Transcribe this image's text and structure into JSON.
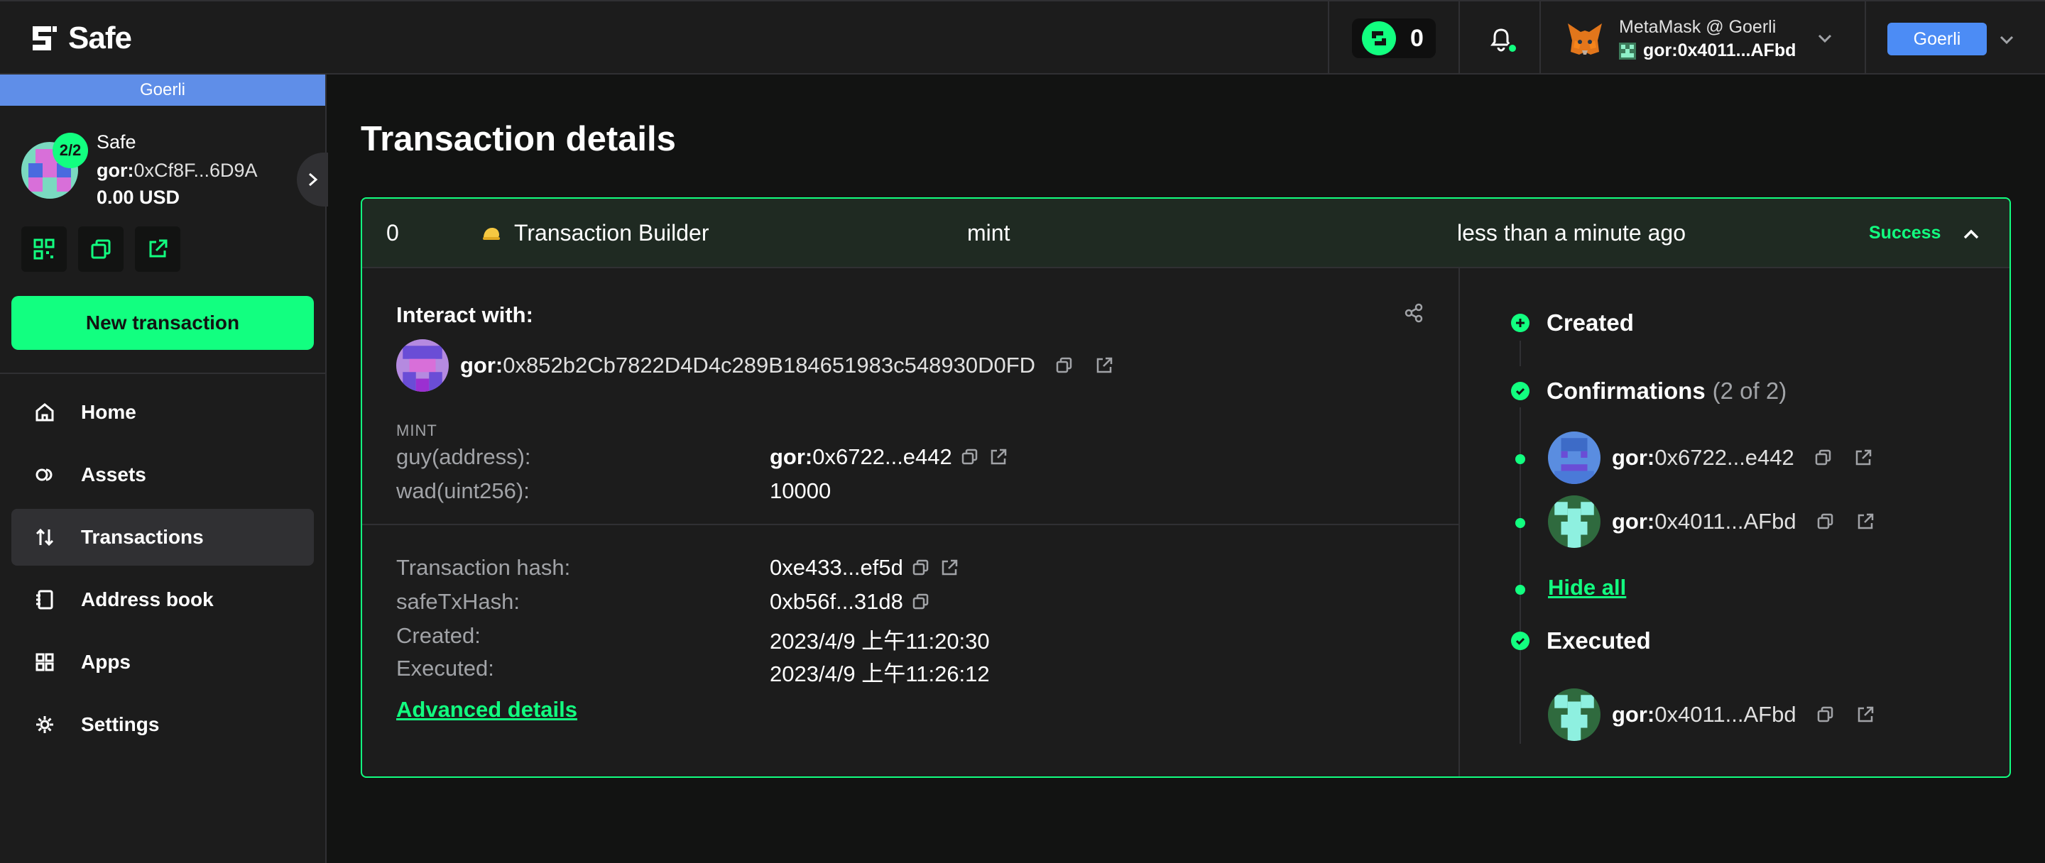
{
  "header": {
    "logo_text": "Safe",
    "token_count": "0",
    "wallet_name": "MetaMask @ Goerli",
    "wallet_prefix": "gor:",
    "wallet_addr": "0x4011...AFbd",
    "network_button": "Goerli"
  },
  "sidebar": {
    "network_banner": "Goerli",
    "threshold": "2/2",
    "safe_name": "Safe",
    "safe_prefix": "gor:",
    "safe_addr": "0xCf8F...6D9A",
    "balance": "0.00 USD",
    "new_transaction": "New transaction",
    "nav": [
      {
        "label": "Home",
        "icon": "home-icon"
      },
      {
        "label": "Assets",
        "icon": "assets-icon"
      },
      {
        "label": "Transactions",
        "icon": "transactions-icon"
      },
      {
        "label": "Address book",
        "icon": "address-book-icon"
      },
      {
        "label": "Apps",
        "icon": "apps-icon"
      },
      {
        "label": "Settings",
        "icon": "settings-icon"
      }
    ]
  },
  "main": {
    "title": "Transaction details",
    "summary": {
      "nonce": "0",
      "app": "Transaction Builder",
      "method": "mint",
      "time": "less than a minute ago",
      "status": "Success"
    },
    "details": {
      "interact_label": "Interact with:",
      "contract_prefix": "gor:",
      "contract_addr": "0x852b2Cb7822D4D4c289B184651983c548930D0FD",
      "method_label": "MINT",
      "params": [
        {
          "key": "guy(address):",
          "prefix": "gor:",
          "value": "0x6722...e442"
        },
        {
          "key": "wad(uint256):",
          "value": "10000"
        }
      ],
      "tx_hash_label": "Transaction hash:",
      "tx_hash": "0xe433...ef5d",
      "safe_tx_hash_label": "safeTxHash:",
      "safe_tx_hash": "0xb56f...31d8",
      "created_label": "Created:",
      "created": "2023/4/9 上午11:20:30",
      "executed_label": "Executed:",
      "executed": "2023/4/9 上午11:26:12",
      "advanced": "Advanced details"
    },
    "timeline": {
      "created": "Created",
      "confirmations": "Confirmations",
      "confirmations_count": "(2 of 2)",
      "signers": [
        {
          "prefix": "gor:",
          "addr": "0x6722...e442"
        },
        {
          "prefix": "gor:",
          "addr": "0x4011...AFbd"
        }
      ],
      "hide_all": "Hide all",
      "executed": "Executed",
      "executor": {
        "prefix": "gor:",
        "addr": "0x4011...AFbd"
      }
    }
  },
  "colors": {
    "accent": "#12ff80",
    "background": "#121312",
    "panel": "#1c1c1c",
    "network": "#4c8cf5"
  }
}
